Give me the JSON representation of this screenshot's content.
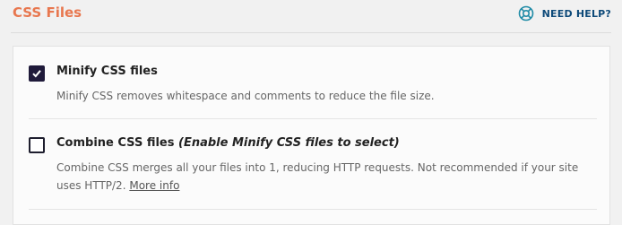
{
  "header": {
    "title": "CSS Files",
    "help_label": "NEED HELP?",
    "help_icon": "lifebuoy-icon"
  },
  "colors": {
    "title": "#e8774f",
    "help": "#0e4a79",
    "checkbox_checked": "#1f1a3a"
  },
  "options": [
    {
      "label": "Minify CSS files",
      "checked": true,
      "description": "Minify CSS removes whitespace and comments to reduce the file size."
    },
    {
      "label": "Combine CSS files",
      "note": "(Enable Minify CSS files to select)",
      "checked": false,
      "description": "Combine CSS merges all your files into 1, reducing HTTP requests. Not recommended if your site uses HTTP/2.",
      "link": "More info"
    }
  ]
}
